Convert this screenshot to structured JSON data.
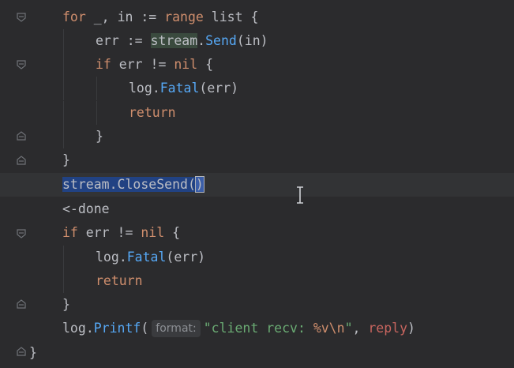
{
  "editor": {
    "language": "Go",
    "lines": [
      {
        "tokens": [
          {
            "t": "for",
            "c": "kw"
          },
          {
            "t": " _, ",
            "c": "ident"
          },
          {
            "t": "in",
            "c": "ident"
          },
          {
            "t": " := ",
            "c": "ident"
          },
          {
            "t": "range",
            "c": "kw"
          },
          {
            "t": " list {",
            "c": "ident"
          }
        ]
      },
      {
        "tokens": [
          {
            "t": "err",
            "c": "ident"
          },
          {
            "t": " := ",
            "c": "ident"
          },
          {
            "t": "stream",
            "c": "usage"
          },
          {
            "t": ".",
            "c": "ident"
          },
          {
            "t": "Send",
            "c": "fn"
          },
          {
            "t": "(in)",
            "c": "ident"
          }
        ]
      },
      {
        "tokens": [
          {
            "t": "if",
            "c": "kw"
          },
          {
            "t": " err != ",
            "c": "ident"
          },
          {
            "t": "nil",
            "c": "kw"
          },
          {
            "t": " {",
            "c": "ident"
          }
        ]
      },
      {
        "tokens": [
          {
            "t": "log",
            "c": "pkg"
          },
          {
            "t": ".",
            "c": "ident"
          },
          {
            "t": "Fatal",
            "c": "fn"
          },
          {
            "t": "(err)",
            "c": "ident"
          }
        ]
      },
      {
        "tokens": [
          {
            "t": "return",
            "c": "kw"
          }
        ]
      },
      {
        "tokens": [
          {
            "t": "}",
            "c": "ident"
          }
        ]
      },
      {
        "tokens": [
          {
            "t": "}",
            "c": "ident"
          }
        ]
      },
      {
        "tokens": [
          {
            "t": "stream.CloseSend(",
            "c": "sel"
          },
          {
            "t": ")",
            "c": "brace-match"
          }
        ]
      },
      {
        "tokens": [
          {
            "t": "<-done",
            "c": "ident"
          }
        ]
      },
      {
        "tokens": [
          {
            "t": "if",
            "c": "kw"
          },
          {
            "t": " err != ",
            "c": "ident"
          },
          {
            "t": "nil",
            "c": "kw"
          },
          {
            "t": " {",
            "c": "ident"
          }
        ]
      },
      {
        "tokens": [
          {
            "t": "log",
            "c": "pkg"
          },
          {
            "t": ".",
            "c": "ident"
          },
          {
            "t": "Fatal",
            "c": "fn"
          },
          {
            "t": "(err)",
            "c": "ident"
          }
        ]
      },
      {
        "tokens": [
          {
            "t": "return",
            "c": "kw"
          }
        ]
      },
      {
        "tokens": [
          {
            "t": "}",
            "c": "ident"
          }
        ]
      },
      {
        "tokens": [
          {
            "t": "log",
            "c": "pkg"
          },
          {
            "t": ".",
            "c": "ident"
          },
          {
            "t": "Printf",
            "c": "fn"
          },
          {
            "t": "(",
            "c": "ident"
          },
          {
            "t": "format:",
            "c": "hint"
          },
          {
            "t": "\"client recv: ",
            "c": "str"
          },
          {
            "t": "%v\\n",
            "c": "fmt"
          },
          {
            "t": "\"",
            "c": "str"
          },
          {
            "t": ", ",
            "c": "ident"
          },
          {
            "t": "reply",
            "c": "reply"
          },
          {
            "t": ")",
            "c": "ident"
          }
        ]
      },
      {
        "tokens": [
          {
            "t": "}",
            "c": "ident"
          }
        ]
      }
    ]
  }
}
